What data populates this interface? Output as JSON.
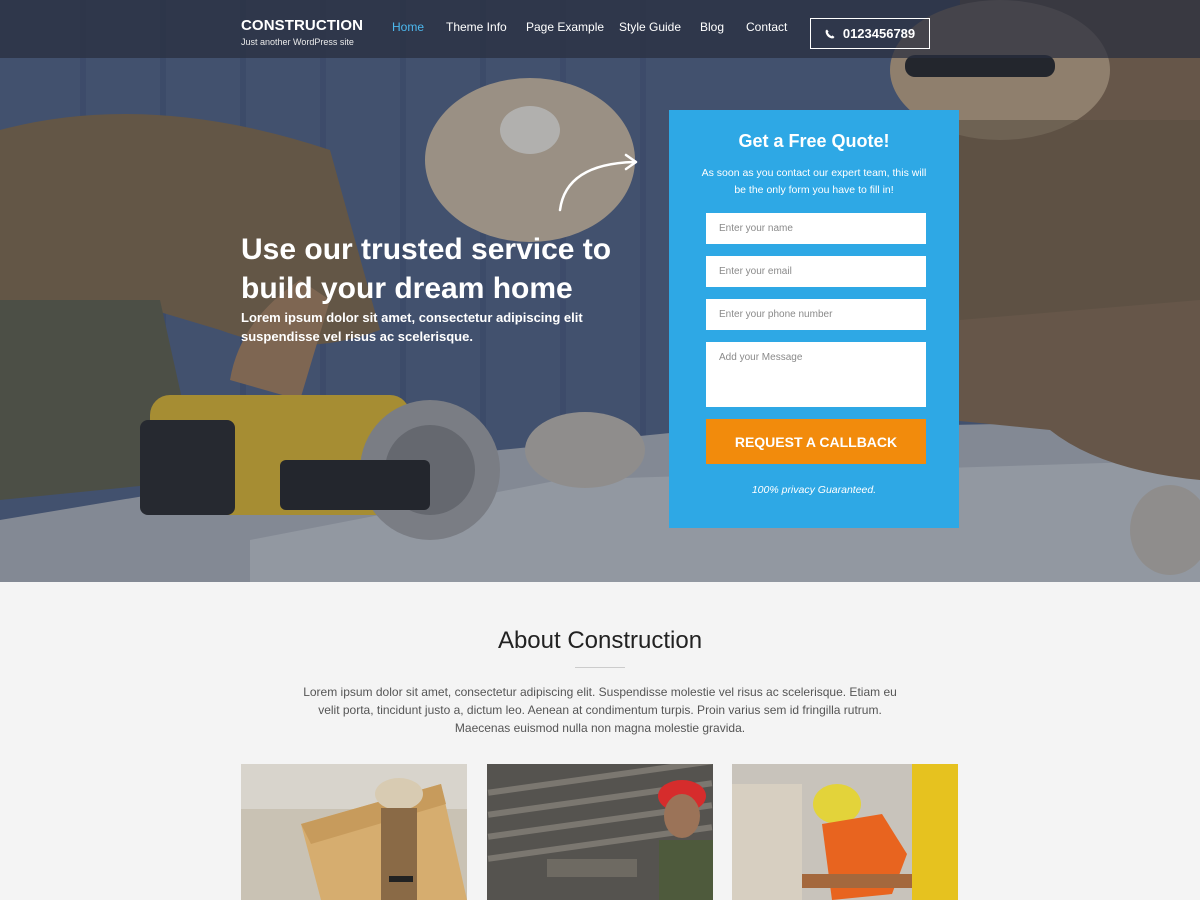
{
  "header": {
    "brand_title": "CONSTRUCTION",
    "brand_tagline": "Just another WordPress site",
    "nav": [
      "Home",
      "Theme Info",
      "Page Example",
      "Style Guide",
      "Blog",
      "Contact"
    ],
    "active_nav": "Home",
    "phone": "0123456789"
  },
  "hero": {
    "heading": "Use our trusted service to build your dream home",
    "subtext": "Lorem ipsum dolor sit amet, consectetur adipiscing elit suspendisse vel risus ac scelerisque."
  },
  "quote_form": {
    "title": "Get a Free Quote!",
    "description": "As soon as you contact our expert team, this will be the only form you have to fill in!",
    "name_placeholder": "Enter your name",
    "email_placeholder": "Enter your email",
    "phone_placeholder": "Enter your phone number",
    "message_placeholder": "Add your Message",
    "button_label": "REQUEST A CALLBACK",
    "privacy_note": "100% privacy Guaranteed."
  },
  "about": {
    "title": "About Construction",
    "text": "Lorem ipsum dolor sit amet, consectetur adipiscing elit. Suspendisse molestie vel risus ac scelerisque. Etiam eu velit porta, tincidunt justo a, dictum leo. Aenean at condimentum turpis. Proin varius sem id fringilla rutrum. Maecenas euismod nulla non magna molestie gravida."
  },
  "colors": {
    "accent_blue": "#2ea8e5",
    "nav_active": "#4cb8ee",
    "cta_orange": "#f28b0c"
  },
  "icons": [
    "phone-icon",
    "arrow-icon"
  ]
}
